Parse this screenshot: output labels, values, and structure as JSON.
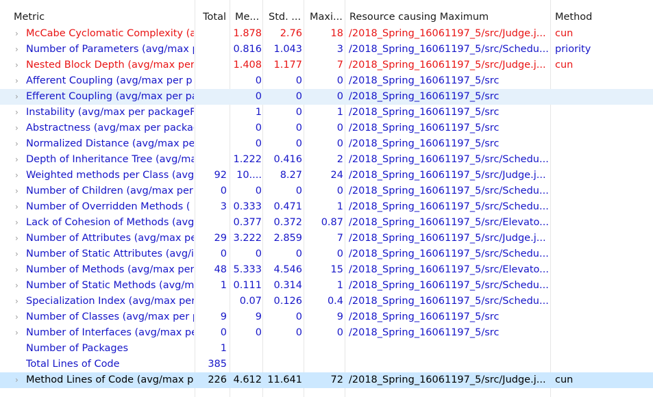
{
  "headers": {
    "metric": "Metric",
    "total": "Total",
    "mean": "Me...",
    "std": "Std. ...",
    "max": "Maxi...",
    "resource": "Resource causing Maximum",
    "method": "Method"
  },
  "arrow_glyph": "›",
  "rows": [
    {
      "metric": "McCabe Cyclomatic Complexity (a",
      "total": "",
      "mean": "1.878",
      "std": "2.76",
      "max": "18",
      "resource": "/2018_Spring_16061197_5/src/Judge.j...",
      "method": "cun",
      "color": "red",
      "has_arrow": true,
      "selected": ""
    },
    {
      "metric": "Number of Parameters (avg/max p",
      "total": "",
      "mean": "0.816",
      "std": "1.043",
      "max": "3",
      "resource": "/2018_Spring_16061197_5/src/Schedu...",
      "method": "priority",
      "color": "blue",
      "has_arrow": true,
      "selected": ""
    },
    {
      "metric": "Nested Block Depth (avg/max per",
      "total": "",
      "mean": "1.408",
      "std": "1.177",
      "max": "7",
      "resource": "/2018_Spring_16061197_5/src/Judge.j...",
      "method": "cun",
      "color": "red",
      "has_arrow": true,
      "selected": ""
    },
    {
      "metric": "Afferent Coupling (avg/max per p",
      "total": "",
      "mean": "0",
      "std": "0",
      "max": "0",
      "resource": "/2018_Spring_16061197_5/src",
      "method": "",
      "color": "blue",
      "has_arrow": true,
      "selected": ""
    },
    {
      "metric": "Efferent Coupling (avg/max per pa",
      "total": "",
      "mean": "0",
      "std": "0",
      "max": "0",
      "resource": "/2018_Spring_16061197_5/src",
      "method": "",
      "color": "blue",
      "has_arrow": true,
      "selected": "light"
    },
    {
      "metric": "Instability (avg/max per packageFi",
      "total": "",
      "mean": "1",
      "std": "0",
      "max": "1",
      "resource": "/2018_Spring_16061197_5/src",
      "method": "",
      "color": "blue",
      "has_arrow": true,
      "selected": ""
    },
    {
      "metric": "Abstractness (avg/max per packag",
      "total": "",
      "mean": "0",
      "std": "0",
      "max": "0",
      "resource": "/2018_Spring_16061197_5/src",
      "method": "",
      "color": "blue",
      "has_arrow": true,
      "selected": ""
    },
    {
      "metric": "Normalized Distance (avg/max pe",
      "total": "",
      "mean": "0",
      "std": "0",
      "max": "0",
      "resource": "/2018_Spring_16061197_5/src",
      "method": "",
      "color": "blue",
      "has_arrow": true,
      "selected": ""
    },
    {
      "metric": "Depth of Inheritance Tree (avg/ma",
      "total": "",
      "mean": "1.222",
      "std": "0.416",
      "max": "2",
      "resource": "/2018_Spring_16061197_5/src/Schedu...",
      "method": "",
      "color": "blue",
      "has_arrow": true,
      "selected": ""
    },
    {
      "metric": "Weighted methods per Class (avg",
      "total": "92",
      "mean": "10....",
      "std": "8.27",
      "max": "24",
      "resource": "/2018_Spring_16061197_5/src/Judge.j...",
      "method": "",
      "color": "blue",
      "has_arrow": true,
      "selected": ""
    },
    {
      "metric": "Number of Children (avg/max per",
      "total": "0",
      "mean": "0",
      "std": "0",
      "max": "0",
      "resource": "/2018_Spring_16061197_5/src/Schedu...",
      "method": "",
      "color": "blue",
      "has_arrow": true,
      "selected": ""
    },
    {
      "metric": "Number of Overridden Methods (",
      "total": "3",
      "mean": "0.333",
      "std": "0.471",
      "max": "1",
      "resource": "/2018_Spring_16061197_5/src/Schedu...",
      "method": "",
      "color": "blue",
      "has_arrow": true,
      "selected": ""
    },
    {
      "metric": "Lack of Cohesion of Methods (avg",
      "total": "",
      "mean": "0.377",
      "std": "0.372",
      "max": "0.87",
      "resource": "/2018_Spring_16061197_5/src/Elevato...",
      "method": "",
      "color": "blue",
      "has_arrow": true,
      "selected": ""
    },
    {
      "metric": "Number of Attributes (avg/max pe",
      "total": "29",
      "mean": "3.222",
      "std": "2.859",
      "max": "7",
      "resource": "/2018_Spring_16061197_5/src/Judge.j...",
      "method": "",
      "color": "blue",
      "has_arrow": true,
      "selected": ""
    },
    {
      "metric": "Number of Static Attributes (avg/i",
      "total": "0",
      "mean": "0",
      "std": "0",
      "max": "0",
      "resource": "/2018_Spring_16061197_5/src/Schedu...",
      "method": "",
      "color": "blue",
      "has_arrow": true,
      "selected": ""
    },
    {
      "metric": "Number of Methods (avg/max per",
      "total": "48",
      "mean": "5.333",
      "std": "4.546",
      "max": "15",
      "resource": "/2018_Spring_16061197_5/src/Elevato...",
      "method": "",
      "color": "blue",
      "has_arrow": true,
      "selected": ""
    },
    {
      "metric": "Number of Static Methods (avg/m",
      "total": "1",
      "mean": "0.111",
      "std": "0.314",
      "max": "1",
      "resource": "/2018_Spring_16061197_5/src/Schedu...",
      "method": "",
      "color": "blue",
      "has_arrow": true,
      "selected": ""
    },
    {
      "metric": "Specialization Index (avg/max per",
      "total": "",
      "mean": "0.07",
      "std": "0.126",
      "max": "0.4",
      "resource": "/2018_Spring_16061197_5/src/Schedu...",
      "method": "",
      "color": "blue",
      "has_arrow": true,
      "selected": ""
    },
    {
      "metric": "Number of Classes (avg/max per p",
      "total": "9",
      "mean": "9",
      "std": "0",
      "max": "9",
      "resource": "/2018_Spring_16061197_5/src",
      "method": "",
      "color": "blue",
      "has_arrow": true,
      "selected": ""
    },
    {
      "metric": "Number of Interfaces (avg/max pe",
      "total": "0",
      "mean": "0",
      "std": "0",
      "max": "0",
      "resource": "/2018_Spring_16061197_5/src",
      "method": "",
      "color": "blue",
      "has_arrow": true,
      "selected": ""
    },
    {
      "metric": "Number of Packages",
      "total": "1",
      "mean": "",
      "std": "",
      "max": "",
      "resource": "",
      "method": "",
      "color": "blue",
      "has_arrow": false,
      "selected": ""
    },
    {
      "metric": "Total Lines of Code",
      "total": "385",
      "mean": "",
      "std": "",
      "max": "",
      "resource": "",
      "method": "",
      "color": "blue",
      "has_arrow": false,
      "selected": ""
    },
    {
      "metric": "Method Lines of Code (avg/max p",
      "total": "226",
      "mean": "4.612",
      "std": "11.641",
      "max": "72",
      "resource": "/2018_Spring_16061197_5/src/Judge.j...",
      "method": "cun",
      "color": "black",
      "has_arrow": true,
      "selected": "dark"
    }
  ]
}
